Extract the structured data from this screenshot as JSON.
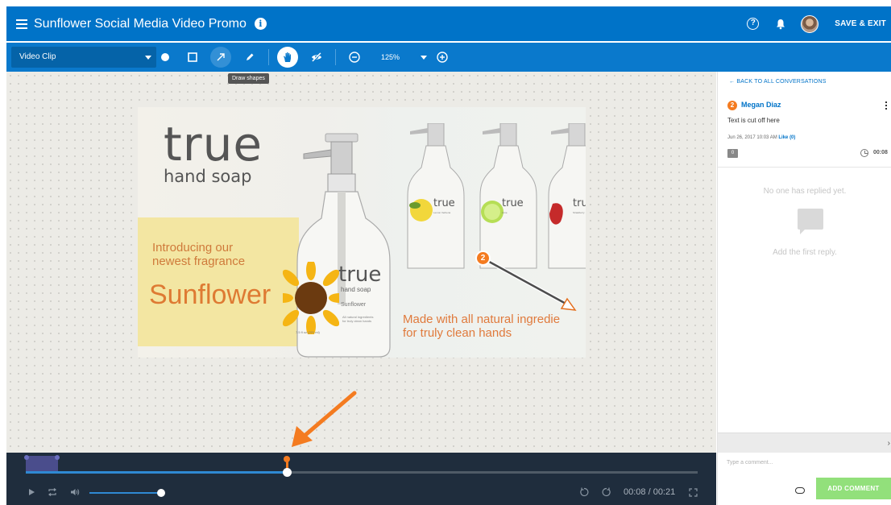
{
  "header": {
    "title": "Sunflower Social Media Video Promo",
    "save_exit": "SAVE & EXIT",
    "colors": {
      "bar": "#0073c8"
    },
    "icons": [
      "menu-icon",
      "info-icon",
      "help-icon",
      "bell-icon",
      "avatar"
    ]
  },
  "toolbar": {
    "media_select": "Video Clip",
    "zoom": "125%",
    "tooltip": "Draw shapes",
    "tools": [
      "circle-tool-icon",
      "rectangle-tool-icon",
      "arrow-tool-icon",
      "pencil-tool-icon",
      "hand-tool-icon",
      "hide-markup-icon",
      "zoom-out-icon",
      "zoom-in-icon"
    ]
  },
  "video": {
    "brand": "true",
    "brand_sub": "hand soap",
    "intro_line1": "Introducing our",
    "intro_line2": "newest fragrance",
    "product": "Sunflower",
    "bottle_brand": "true",
    "bottle_sub": "hand soap",
    "bottle_name": "Sunflower",
    "bottle_desc1": "All natural ingredients",
    "bottle_desc2": "for truly clean hands",
    "bottle_size": "7.5 fl oz (221 ml)",
    "small_bottle_brand": "true",
    "small_bottle_names": [
      "Lemon Verbena",
      "Lime",
      "Strawberry"
    ],
    "tagline_line1": "Made with all natural ingredie",
    "tagline_line2": "for truly clean hands",
    "annotation_badge": "2",
    "colors": {
      "accent": "#de7a33",
      "annotation": "#f47b20"
    }
  },
  "timeline": {
    "time": "00:08 / 00:21",
    "progress": 0.38,
    "volume": 1.0,
    "colors": {
      "bg": "#1f2d3d",
      "progress": "#2f89d3",
      "marker": "#f47b20"
    }
  },
  "panel": {
    "back_link": "← BACK TO ALL CONVERSATIONS",
    "badge": "2",
    "author": "Megan Diaz",
    "comment": "Text is cut off here",
    "date": "Jun 26, 2017 10:03 AM",
    "like": "Like (0)",
    "reply_count": "0",
    "timestamp": "00:08",
    "no_replies": "No one has replied yet.",
    "add_first": "Add the first reply.",
    "collapse": "›",
    "input_placeholder": "Type a comment...",
    "add_button": "ADD COMMENT",
    "colors": {
      "link": "#0073c8",
      "add_button": "#92e07b"
    }
  }
}
